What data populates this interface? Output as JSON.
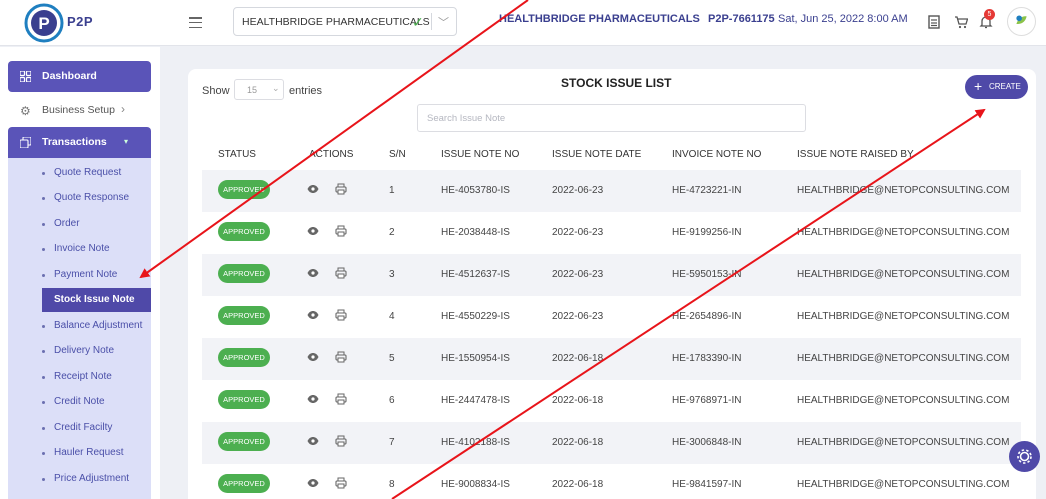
{
  "header": {
    "logo_text": "P2P",
    "company_select": "HEALTHBRIDGE PHARMACEUTICALS",
    "company_name": "HEALTHBRIDGE PHARMACEUTICALS",
    "p2p_id": "P2P-7661175",
    "datetime": "Sat, Jun 25, 2022 8:00 AM",
    "notification_count": "5"
  },
  "sidebar": {
    "dashboard": "Dashboard",
    "business_setup": "Business Setup",
    "transactions": "Transactions",
    "sub_items": [
      "Quote Request",
      "Quote Response",
      "Order",
      "Invoice Note",
      "Payment Note",
      "Stock Issue Note",
      "Balance Adjustment",
      "Delivery Note",
      "Receipt Note",
      "Credit Note",
      "Credit Facilty",
      "Hauler Request",
      "Price Adjustment"
    ],
    "active_item": "Stock Issue Note"
  },
  "main": {
    "title": "STOCK ISSUE LIST",
    "show_label": "Show",
    "entries_value": "15",
    "entries_label": "entries",
    "create_label": "CREATE",
    "search_placeholder": "Search Issue Note",
    "columns": [
      "STATUS",
      "ACTIONS",
      "S/N",
      "ISSUE NOTE NO",
      "ISSUE NOTE DATE",
      "INVOICE NOTE NO",
      "ISSUE NOTE RAISED BY"
    ],
    "rows": [
      {
        "status": "APPROVED",
        "sn": "1",
        "issue_no": "HE-4053780-IS",
        "date": "2022-06-23",
        "invoice_no": "HE-4723221-IN",
        "raised_by": "HEALTHBRIDGE@NETOPCONSULTING.COM"
      },
      {
        "status": "APPROVED",
        "sn": "2",
        "issue_no": "HE-2038448-IS",
        "date": "2022-06-23",
        "invoice_no": "HE-9199256-IN",
        "raised_by": "HEALTHBRIDGE@NETOPCONSULTING.COM"
      },
      {
        "status": "APPROVED",
        "sn": "3",
        "issue_no": "HE-4512637-IS",
        "date": "2022-06-23",
        "invoice_no": "HE-5950153-IN",
        "raised_by": "HEALTHBRIDGE@NETOPCONSULTING.COM"
      },
      {
        "status": "APPROVED",
        "sn": "4",
        "issue_no": "HE-4550229-IS",
        "date": "2022-06-23",
        "invoice_no": "HE-2654896-IN",
        "raised_by": "HEALTHBRIDGE@NETOPCONSULTING.COM"
      },
      {
        "status": "APPROVED",
        "sn": "5",
        "issue_no": "HE-1550954-IS",
        "date": "2022-06-18",
        "invoice_no": "HE-1783390-IN",
        "raised_by": "HEALTHBRIDGE@NETOPCONSULTING.COM"
      },
      {
        "status": "APPROVED",
        "sn": "6",
        "issue_no": "HE-2447478-IS",
        "date": "2022-06-18",
        "invoice_no": "HE-9768971-IN",
        "raised_by": "HEALTHBRIDGE@NETOPCONSULTING.COM"
      },
      {
        "status": "APPROVED",
        "sn": "7",
        "issue_no": "HE-4102188-IS",
        "date": "2022-06-18",
        "invoice_no": "HE-3006848-IN",
        "raised_by": "HEALTHBRIDGE@NETOPCONSULTING.COM"
      },
      {
        "status": "APPROVED",
        "sn": "8",
        "issue_no": "HE-9008834-IS",
        "date": "2022-06-18",
        "invoice_no": "HE-9841597-IN",
        "raised_by": "HEALTHBRIDGE@NETOPCONSULTING.COM"
      }
    ]
  },
  "colors": {
    "primary": "#4f49a8",
    "approved": "#4caf50",
    "annotation_arrow": "#e8141a"
  },
  "icons": [
    "hamburger-menu-icon",
    "check-icon",
    "chevron-down-icon",
    "document-icon",
    "cart-icon",
    "bell-icon",
    "dashboard-grid-icon",
    "gear-icon",
    "chevron-right-icon",
    "copy-icon",
    "plus-icon",
    "eye-icon",
    "print-icon",
    "settings-icon"
  ]
}
